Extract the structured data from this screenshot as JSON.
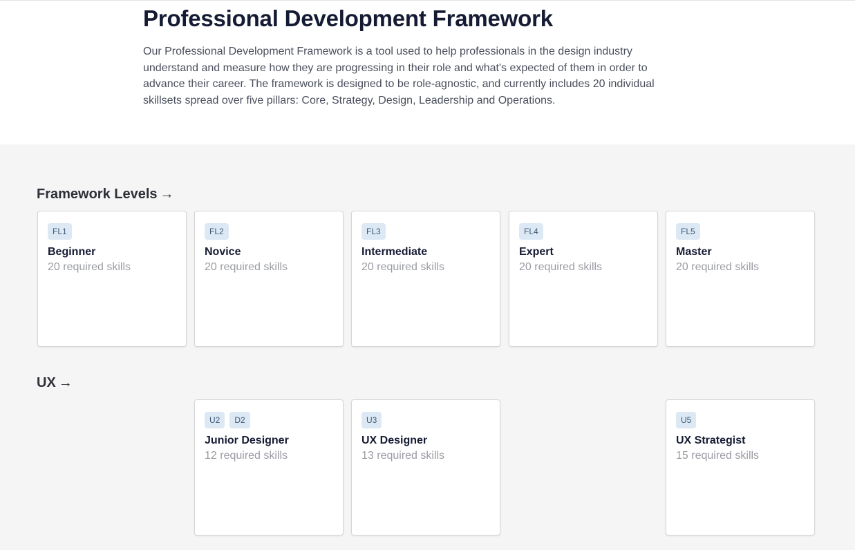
{
  "header": {
    "title": "Professional Development Framework",
    "intro": "Our Professional Development Framework is a tool used to help professionals in the design industry understand and measure how they are progressing in their role and what's expected of them in order to advance their career. The framework is designed to be role-agnostic, and currently includes 20 individual skillsets spread over five pillars: Core, Strategy, Design, Leadership and Operations."
  },
  "sections": [
    {
      "title": "Framework Levels",
      "arrow": "→",
      "cards": [
        {
          "tags": [
            "FL1"
          ],
          "title": "Beginner",
          "subtitle": "20 required skills"
        },
        {
          "tags": [
            "FL2"
          ],
          "title": "Novice",
          "subtitle": "20 required skills"
        },
        {
          "tags": [
            "FL3"
          ],
          "title": "Intermediate",
          "subtitle": "20 required skills"
        },
        {
          "tags": [
            "FL4"
          ],
          "title": "Expert",
          "subtitle": "20 required skills"
        },
        {
          "tags": [
            "FL5"
          ],
          "title": "Master",
          "subtitle": "20 required skills"
        }
      ]
    },
    {
      "title": "UX",
      "arrow": "→",
      "cards": [
        {
          "tags": [
            "U2",
            "D2"
          ],
          "title": "Junior Designer",
          "subtitle": "12 required skills"
        },
        {
          "tags": [
            "U3"
          ],
          "title": "UX Designer",
          "subtitle": "13 required skills"
        },
        {
          "tags": [
            "U5"
          ],
          "title": "UX Strategist",
          "subtitle": "15 required skills"
        }
      ]
    }
  ],
  "colors": {
    "title": "#151b33",
    "tag_bg": "#dce9f5",
    "tag_text": "#3f5a75",
    "subtitle": "#9a9ca3",
    "section_bg": "#f5f5f5"
  }
}
